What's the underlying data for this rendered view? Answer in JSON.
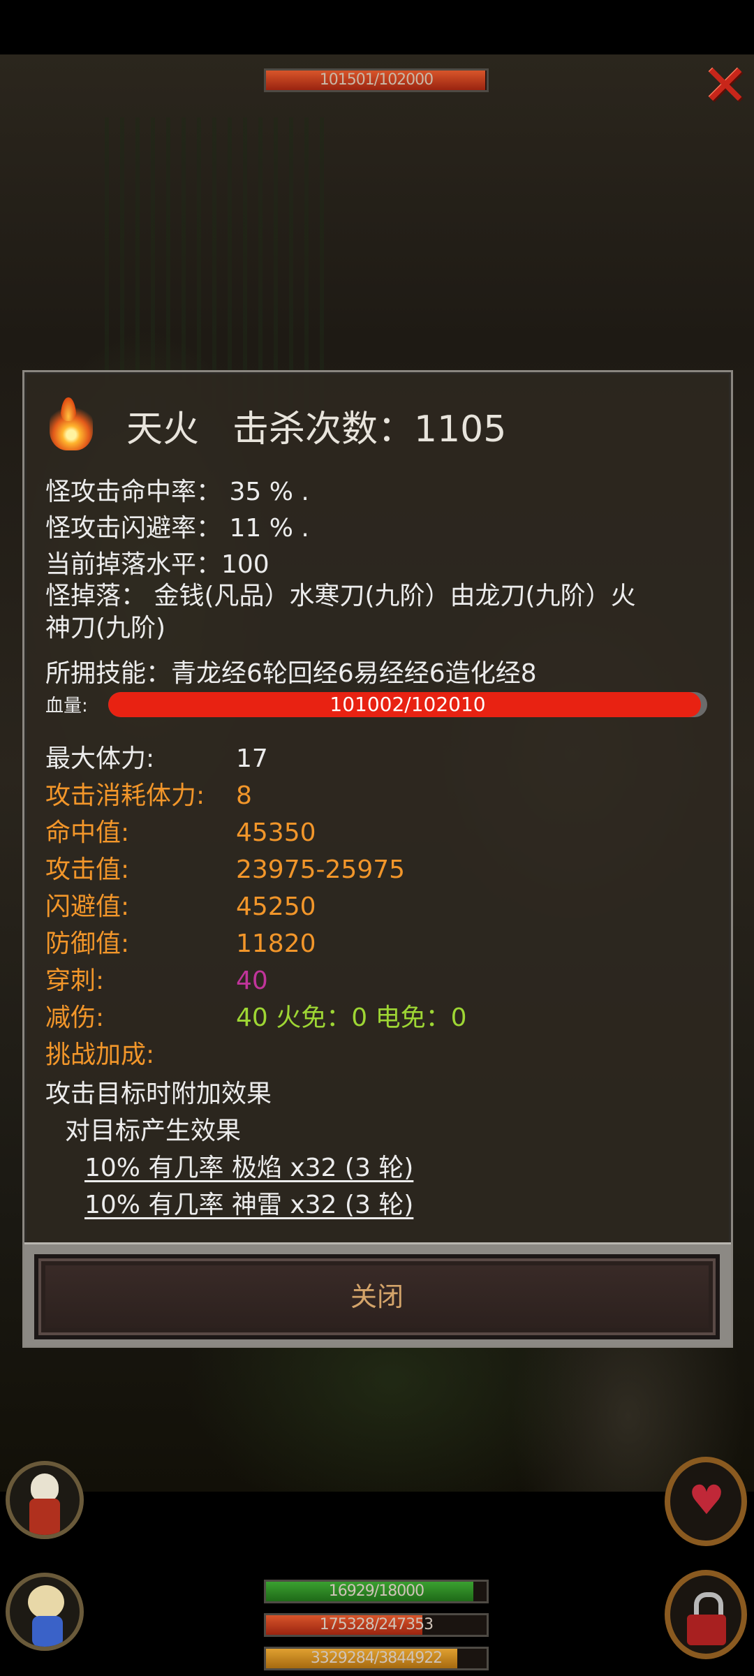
{
  "top_bar": {
    "hp_text": "101501/102000",
    "hp_fraction": 0.995
  },
  "monster": {
    "name": "天火",
    "kill_count_text": "击杀次数：1105",
    "hit_rate": "怪攻击命中率：  35 % .",
    "dodge_rate": "怪攻击闪避率：  11 % .",
    "drop_level": "当前掉落水平：100",
    "drops_line1": "怪掉落：  金钱(凡品）水寒刀(九阶）由龙刀(九阶）火",
    "drops_line2": "神刀(九阶)",
    "skills": "所拥技能：青龙经6轮回经6易经经6造化经8",
    "hp_label": "血量:",
    "hp_text": "101002/102010",
    "hp_fraction": 0.99
  },
  "stats": [
    {
      "label": "最大体力:",
      "value": "17",
      "label_color": "#ececec",
      "value_color": "#ececec"
    },
    {
      "label": "攻击消耗体力:",
      "value": "8",
      "label_color": "#f2962a",
      "value_color": "#f2962a"
    },
    {
      "label": "命中值:",
      "value": "45350",
      "label_color": "#f2962a",
      "value_color": "#f2962a"
    },
    {
      "label": "攻击值:",
      "value": "23975-25975",
      "label_color": "#f2962a",
      "value_color": "#f2962a"
    },
    {
      "label": "闪避值:",
      "value": "45250",
      "label_color": "#f2962a",
      "value_color": "#f2962a"
    },
    {
      "label": "防御值:",
      "value": "11820",
      "label_color": "#f2962a",
      "value_color": "#f2962a"
    },
    {
      "label": "穿刺:",
      "value": "40",
      "label_color": "#f2962a",
      "value_color": "#c0349a"
    },
    {
      "label": "减伤:",
      "value": "40 火免：0 电免：0",
      "label_color": "#f2962a",
      "value_color": "#9ed634"
    },
    {
      "label": "挑战加成:",
      "value": "",
      "label_color": "#f2962a",
      "value_color": "#f2962a"
    }
  ],
  "effects": {
    "title": "攻击目标时附加效果",
    "sub": "对目标产生效果",
    "items": [
      "10% 有几率 极焰 x32 (3 轮)",
      "10% 有几率 神雷 x32 (3 轮)"
    ]
  },
  "close_button": "关闭",
  "hud": {
    "bar1_text": "16929/18000",
    "bar1_fraction": 0.94,
    "bar2_text": "175328/247353",
    "bar2_fraction": 0.709,
    "bar3_text": "3329284/3844922",
    "bar3_fraction": 0.866
  },
  "icons": {
    "close": "close-x-icon",
    "fire": "fire-icon",
    "heart": "heart-icon",
    "lock": "lock-icon"
  }
}
